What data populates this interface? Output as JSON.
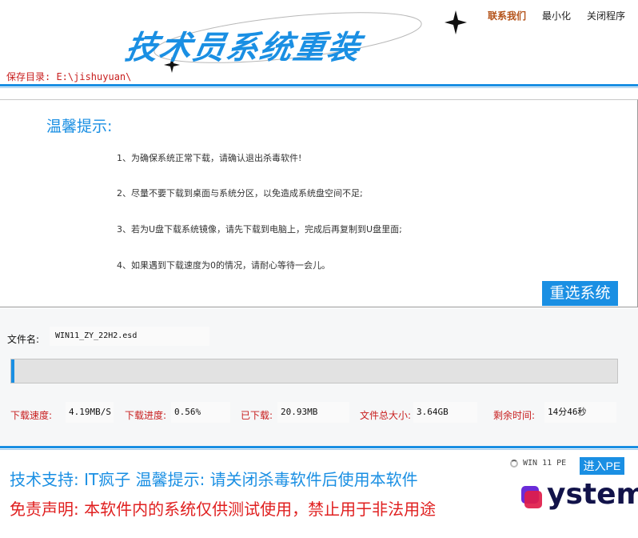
{
  "header": {
    "logo_text": "技术员系统重装",
    "save_path": "保存目录: E:\\jishuyuan\\",
    "menu": {
      "contact": "联系我们",
      "minimize": "最小化",
      "close": "关闭程序"
    }
  },
  "tips": {
    "title": "温馨提示:",
    "items": [
      "1、为确保系统正常下载，请确认退出杀毒软件!",
      "2、尽量不要下载到桌面与系统分区，以免造成系统盘空间不足;",
      "3、若为U盘下载系统镜像，请先下载到电脑上，完成后再复制到U盘里面;",
      "4、如果遇到下载速度为0的情况，请耐心等待一会儿。"
    ],
    "reselect_button": "重选系统"
  },
  "download": {
    "file_label": "文件名:",
    "file_name": "WIN11_ZY_22H2.esd",
    "progress_fraction": 0.0056,
    "stats": {
      "speed_label": "下载速度:",
      "speed_value": "4.19MB/S",
      "progress_label": "下载进度:",
      "progress_value": "0.56%",
      "downloaded_label": "已下载:",
      "downloaded_value": "20.93MB",
      "total_label": "文件总大小:",
      "total_value": "3.64GB",
      "remaining_label": "剩余时间:",
      "remaining_value": "14分46秒"
    }
  },
  "footer": {
    "support": "技术支持: IT疯子   温馨提示: 请关闭杀毒软件后使用本软件",
    "disclaimer": "免责声明: 本软件内的系统仅供测试使用，禁止用于非法用途",
    "pe_option": "WIN 11 PE",
    "enter_pe_button": "进入PE",
    "brand_logo_text": "ystem"
  },
  "colors": {
    "accent": "#1a8fe3",
    "warning_red": "#e02020",
    "label_red": "#c81e1e",
    "contact_brown": "#b4531a"
  }
}
